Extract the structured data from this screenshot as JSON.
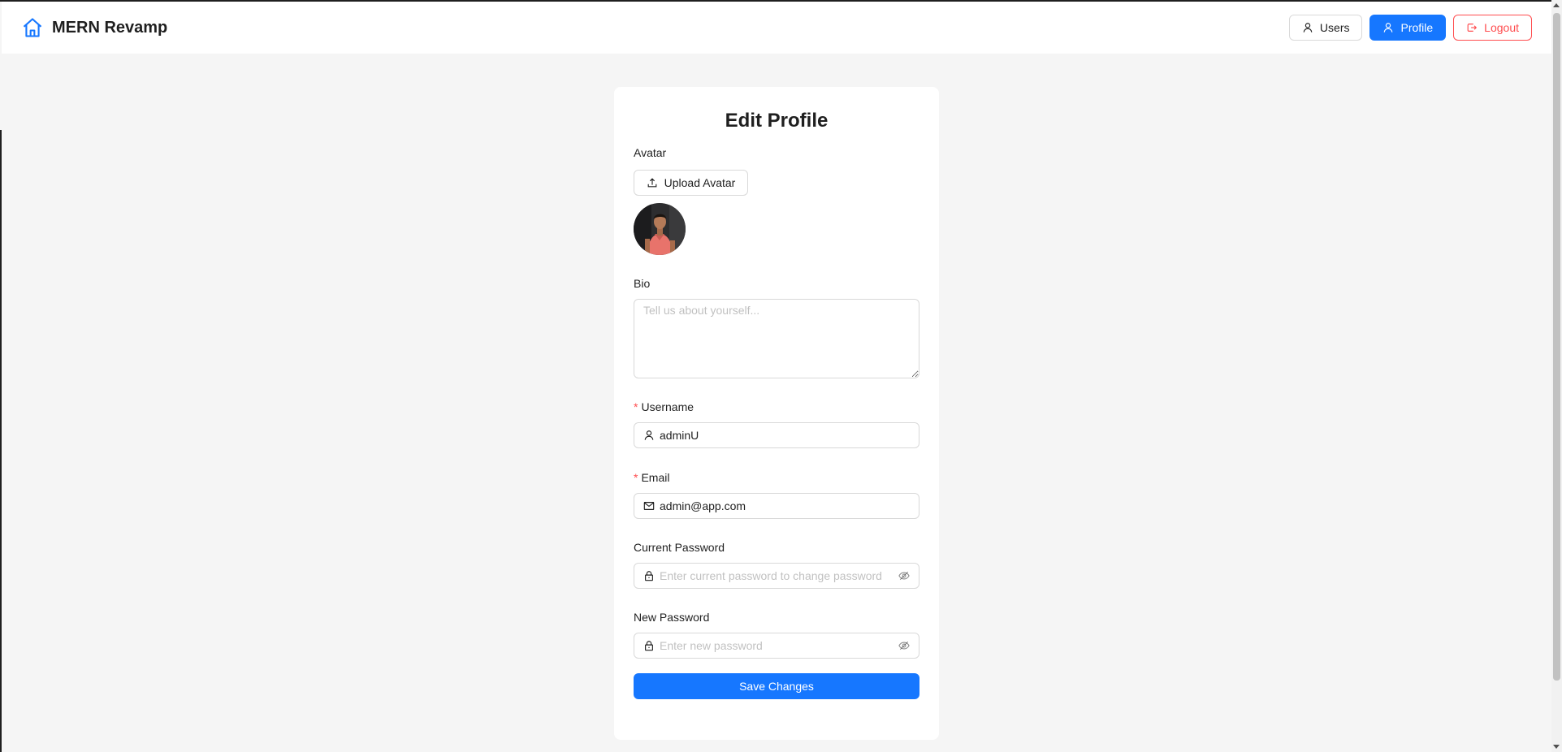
{
  "header": {
    "brand_title": "MERN Revamp",
    "nav": {
      "users_label": "Users",
      "profile_label": "Profile",
      "logout_label": "Logout"
    }
  },
  "colors": {
    "primary": "#1677ff",
    "danger": "#ff4d4f",
    "background": "#f5f5f5"
  },
  "form": {
    "title": "Edit Profile",
    "avatar": {
      "label": "Avatar",
      "upload_label": "Upload Avatar"
    },
    "bio": {
      "label": "Bio",
      "value": "",
      "placeholder": "Tell us about yourself..."
    },
    "username": {
      "label": "Username",
      "required_mark": "*",
      "value": "adminU",
      "icon": "user-icon"
    },
    "email": {
      "label": "Email",
      "required_mark": "*",
      "value": "admin@app.com",
      "icon": "mail-icon"
    },
    "current_password": {
      "label": "Current Password",
      "value": "",
      "placeholder": "Enter current password to change password",
      "icon": "lock-icon",
      "toggle_icon": "eye-invisible-icon"
    },
    "new_password": {
      "label": "New Password",
      "value": "",
      "placeholder": "Enter new password",
      "icon": "lock-icon",
      "toggle_icon": "eye-invisible-icon"
    },
    "save_label": "Save Changes"
  }
}
